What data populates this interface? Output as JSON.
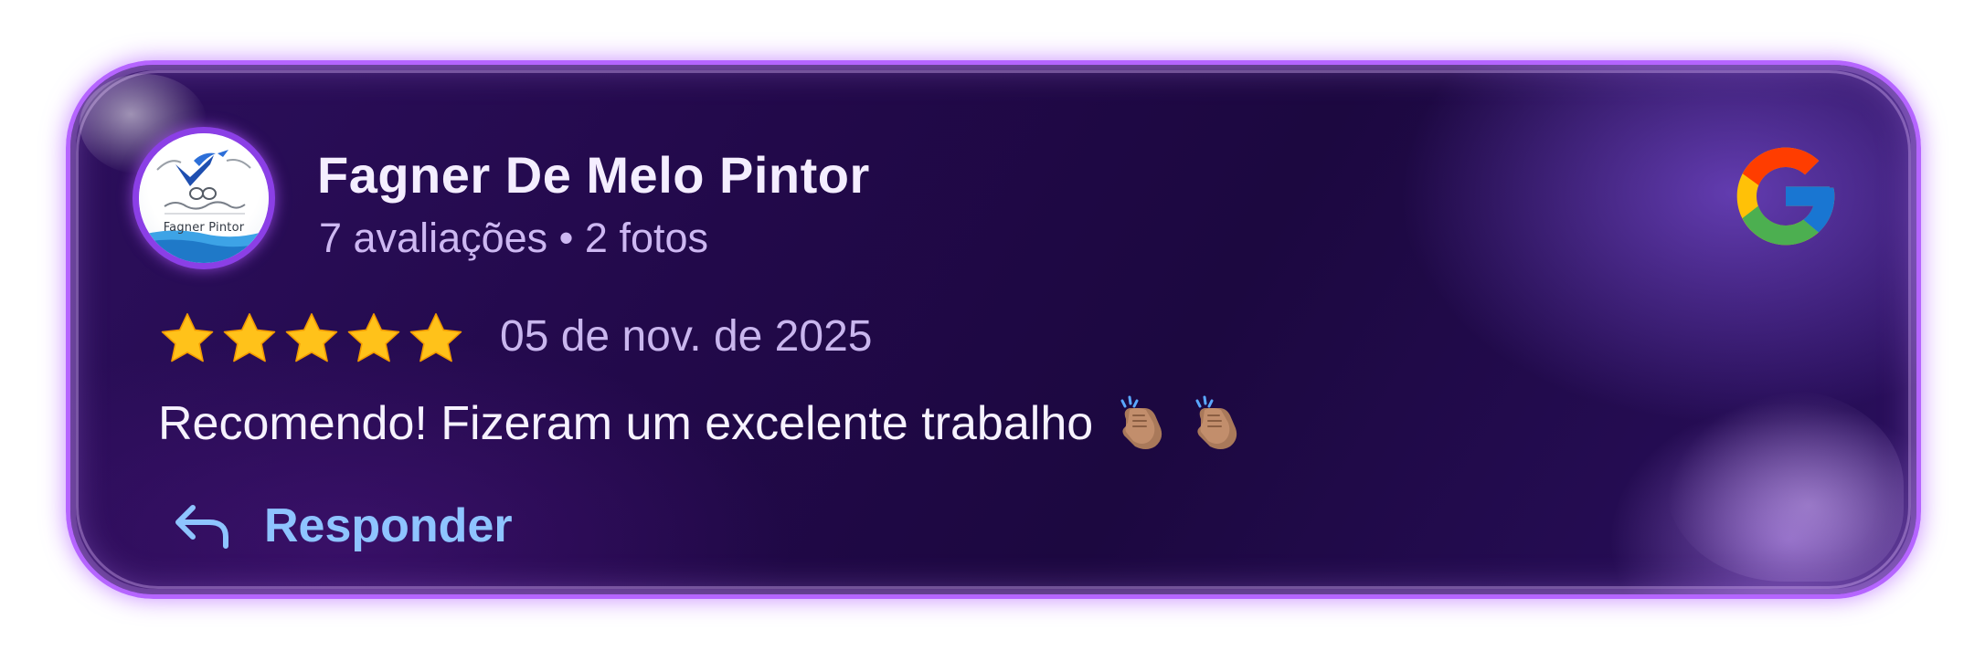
{
  "reviewer": {
    "name": "Fagner De Melo Pintor",
    "meta": "7 avaliações • 2 fotos",
    "avatar_caption": "Fagner Pintor"
  },
  "review": {
    "rating": 5,
    "rating_max": 5,
    "date": "05 de nov. de 2025",
    "text": "Recomendo! Fizeram um excelente trabalho",
    "emojis": [
      "clapping-hands",
      "clapping-hands"
    ]
  },
  "actions": {
    "reply_label": "Responder"
  },
  "icons": {
    "brand": "google-g-logo",
    "reply": "reply-arrow-icon",
    "star": "star-icon"
  },
  "colors": {
    "card_border": "#b565ff",
    "card_background": "#22094a",
    "name_text": "#f4eeff",
    "meta_text": "#cdb8f2",
    "reply_text": "#8ec4ff",
    "star_fill": "#ffc21a"
  }
}
